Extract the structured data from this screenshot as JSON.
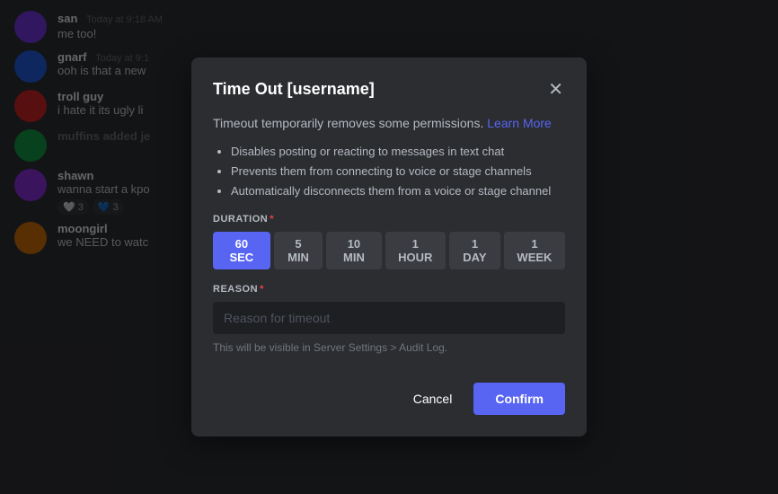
{
  "modal": {
    "title": "Time Out [username]",
    "description": "Timeout temporarily removes some permissions.",
    "learn_more": "Learn More",
    "bullets": [
      "Disables posting or reacting to messages in text chat",
      "Prevents them from connecting to voice or stage channels",
      "Automatically disconnects them from a voice or stage channel"
    ],
    "duration_label": "DURATION",
    "duration_required": "*",
    "duration_options": [
      {
        "label": "60 SEC",
        "active": true
      },
      {
        "label": "5 MIN",
        "active": false
      },
      {
        "label": "10 MIN",
        "active": false
      },
      {
        "label": "1 HOUR",
        "active": false
      },
      {
        "label": "1 DAY",
        "active": false
      },
      {
        "label": "1 WEEK",
        "active": false
      }
    ],
    "reason_label": "REASON",
    "reason_required": "*",
    "reason_placeholder": "Reason for timeout",
    "audit_note": "This will be visible in Server Settings > Audit Log.",
    "cancel_label": "Cancel",
    "confirm_label": "Confirm"
  },
  "chat": {
    "messages": [
      {
        "user": "san",
        "avatar_class": "san",
        "time": "Today at 9:18 AM",
        "text": "me too!"
      },
      {
        "user": "gnarf",
        "avatar_class": "gnarf",
        "time": "Today at 9:1",
        "text": "ooh is that a new"
      },
      {
        "user": "troll guy",
        "avatar_class": "troll",
        "time": "",
        "text": "i hate it its ugly li"
      },
      {
        "user": "muffins added je",
        "avatar_class": "muffins",
        "time": "",
        "text": ""
      },
      {
        "user": "shawn",
        "avatar_class": "shawn",
        "time": "",
        "text": "wanna start a kpo",
        "reactions": [
          "🤍 3",
          "💙 3"
        ]
      },
      {
        "user": "moongirl",
        "avatar_class": "moongirl",
        "time": "",
        "text": "we NEED to watc"
      }
    ]
  },
  "icons": {
    "close": "✕"
  }
}
